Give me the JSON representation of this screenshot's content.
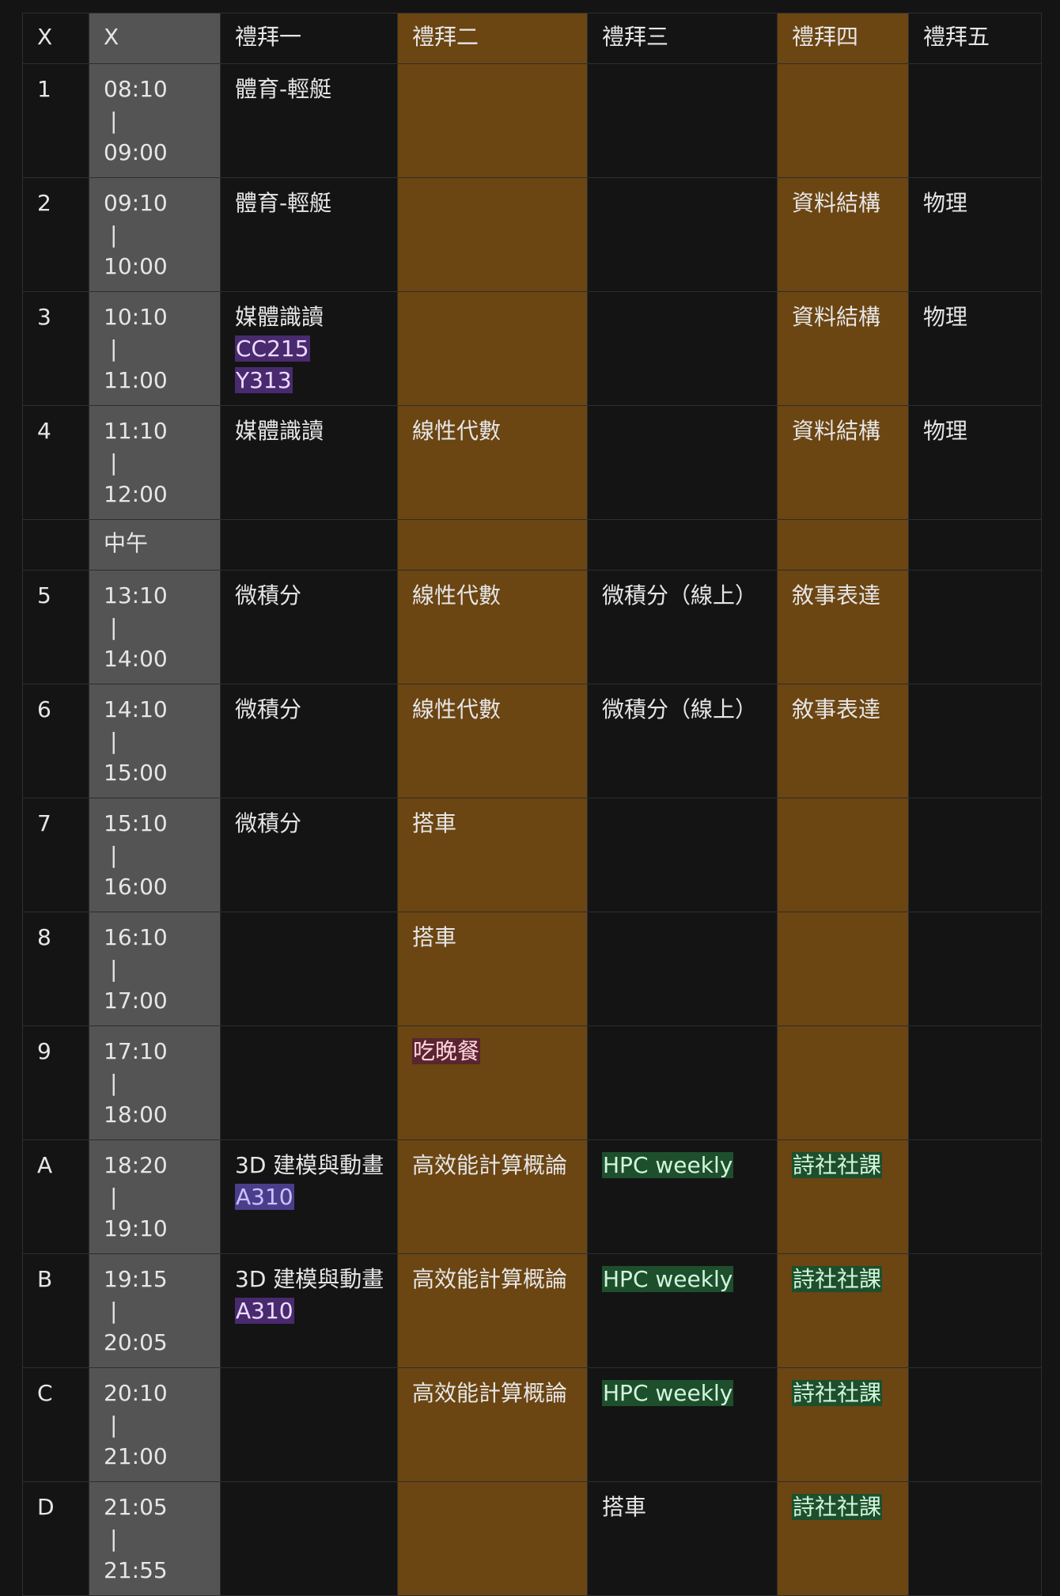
{
  "columns": [
    "X",
    "X",
    "禮拜一",
    "禮拜二",
    "禮拜三",
    "禮拜四",
    "禮拜五"
  ],
  "noon_label": "中午",
  "tag_colors": {
    "purple": {
      "bg": "#4a2a6e",
      "fg": "#eadcff"
    },
    "blue": {
      "bg": "#4a3e8c",
      "fg": "#c9c2ff"
    },
    "red": {
      "bg": "#5a2430",
      "fg": "#ffd6dc"
    },
    "green": {
      "bg": "#1d4f2c",
      "fg": "#d4f5dd"
    }
  },
  "rows": [
    {
      "period": "1",
      "start": "08:10",
      "end": "09:00",
      "cells": [
        [
          {
            "text": "體育-輕艇"
          }
        ],
        [],
        [],
        [],
        []
      ]
    },
    {
      "period": "2",
      "start": "09:10",
      "end": "10:00",
      "cells": [
        [
          {
            "text": "體育-輕艇"
          }
        ],
        [],
        [],
        [
          {
            "text": "資料結構"
          }
        ],
        [
          {
            "text": "物理"
          }
        ]
      ]
    },
    {
      "period": "3",
      "start": "10:10",
      "end": "11:00",
      "cells": [
        [
          {
            "text": "媒體識讀"
          },
          {
            "text": "CC215",
            "tag": "purple"
          },
          {
            "text": "Y313",
            "tag": "purple"
          }
        ],
        [],
        [],
        [
          {
            "text": "資料結構"
          }
        ],
        [
          {
            "text": "物理"
          }
        ]
      ]
    },
    {
      "period": "4",
      "start": "11:10",
      "end": "12:00",
      "cells": [
        [
          {
            "text": "媒體識讀"
          }
        ],
        [
          {
            "text": "線性代數"
          }
        ],
        [],
        [
          {
            "text": "資料結構"
          }
        ],
        [
          {
            "text": "物理"
          }
        ]
      ]
    },
    {
      "noon": true
    },
    {
      "period": "5",
      "start": "13:10",
      "end": "14:00",
      "cells": [
        [
          {
            "text": "微積分"
          }
        ],
        [
          {
            "text": "線性代數"
          }
        ],
        [
          {
            "text": "微積分（線上）"
          }
        ],
        [
          {
            "text": "敘事表達"
          }
        ],
        []
      ]
    },
    {
      "period": "6",
      "start": "14:10",
      "end": "15:00",
      "cells": [
        [
          {
            "text": "微積分"
          }
        ],
        [
          {
            "text": "線性代數"
          }
        ],
        [
          {
            "text": "微積分（線上）"
          }
        ],
        [
          {
            "text": "敘事表達"
          }
        ],
        []
      ]
    },
    {
      "period": "7",
      "start": "15:10",
      "end": "16:00",
      "cells": [
        [
          {
            "text": "微積分"
          }
        ],
        [
          {
            "text": "搭車"
          }
        ],
        [],
        [],
        []
      ]
    },
    {
      "period": "8",
      "start": "16:10",
      "end": "17:00",
      "cells": [
        [],
        [
          {
            "text": "搭車"
          }
        ],
        [],
        [],
        []
      ]
    },
    {
      "period": "9",
      "start": "17:10",
      "end": "18:00",
      "cells": [
        [],
        [
          {
            "text": "吃晚餐",
            "tag": "red"
          }
        ],
        [],
        [],
        []
      ]
    },
    {
      "period": "A",
      "start": "18:20",
      "end": "19:10",
      "cells": [
        [
          {
            "text": "3D 建模與動畫"
          },
          {
            "text": "A310",
            "tag": "blue"
          }
        ],
        [
          {
            "text": "高效能計算概論"
          }
        ],
        [
          {
            "text": "HPC weekly",
            "tag": "green"
          }
        ],
        [
          {
            "text": "詩社社課",
            "tag": "green"
          }
        ],
        []
      ]
    },
    {
      "period": "B",
      "start": "19:15",
      "end": "20:05",
      "cells": [
        [
          {
            "text": "3D 建模與動畫"
          },
          {
            "text": "A310",
            "tag": "purple"
          }
        ],
        [
          {
            "text": "高效能計算概論"
          }
        ],
        [
          {
            "text": "HPC weekly",
            "tag": "green"
          }
        ],
        [
          {
            "text": "詩社社課",
            "tag": "green"
          }
        ],
        []
      ]
    },
    {
      "period": "C",
      "start": "20:10",
      "end": "21:00",
      "cells": [
        [],
        [
          {
            "text": "高效能計算概論"
          }
        ],
        [
          {
            "text": "HPC weekly",
            "tag": "green"
          }
        ],
        [
          {
            "text": "詩社社課",
            "tag": "green"
          }
        ],
        []
      ]
    },
    {
      "period": "D",
      "start": "21:05",
      "end": "21:55",
      "cells": [
        [],
        [],
        [
          {
            "text": "搭車"
          }
        ],
        [
          {
            "text": "詩社社課",
            "tag": "green"
          }
        ],
        []
      ]
    }
  ]
}
